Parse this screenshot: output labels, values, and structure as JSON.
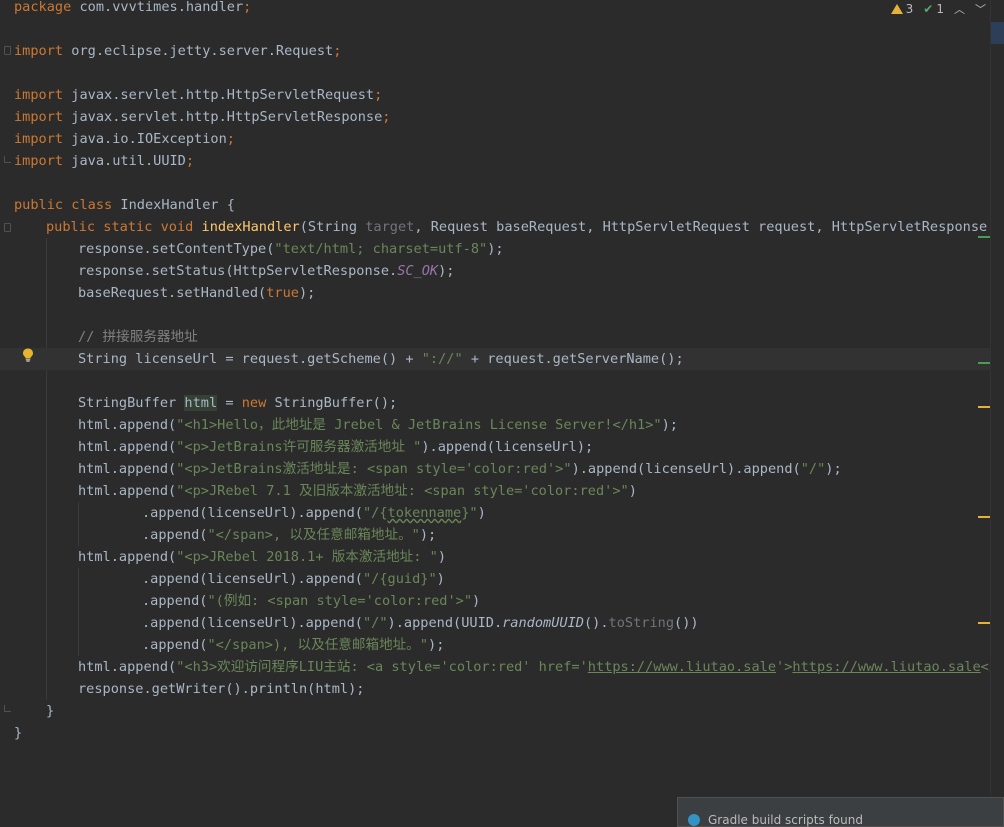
{
  "inspections": {
    "warnings": "3",
    "weak_warnings": "1"
  },
  "code": {
    "package_kw": "package",
    "package_name": " com.vvvtimes.handler",
    "semi": ";",
    "import_kw": "import",
    "imports": [
      " org.eclipse.jetty.server.Request",
      " javax.servlet.http.HttpServletRequest",
      " javax.servlet.http.HttpServletResponse",
      " java.io.IOException",
      " java.util.UUID"
    ],
    "class_decl": {
      "public": "public",
      "class": " class",
      "name": " IndexHandler {"
    },
    "method_decl": {
      "mods": "public static void",
      "name": "indexHandler",
      "open": "(String ",
      "unused_param": "target",
      "rest": ", Request baseRequest, HttpServletRequest request, HttpServletResponse re"
    },
    "l1": {
      "a": "response.setContentType(",
      "s": "\"text/html; charset=utf-8\"",
      "b": ");"
    },
    "l2": {
      "a": "response.setStatus(HttpServletResponse.",
      "f": "SC_OK",
      "b": ");"
    },
    "l3": {
      "a": "baseRequest.setHandled(",
      "k": "true",
      "b": ");"
    },
    "comment": "// 拼接服务器地址",
    "l4": {
      "a": "String licenseUrl = request.getScheme() + ",
      "s": "\"://\"",
      "b": " + request.getServerName();"
    },
    "l5": {
      "a": "StringBuffer ",
      "v": "html",
      "b": " = ",
      "k": "new",
      "c": " StringBuffer();"
    },
    "l6": {
      "a": "html.append(",
      "s": "\"<h1>Hello，此地址是 Jrebel & JetBrains License Server!</h1>\"",
      "b": ");"
    },
    "l7": {
      "a": "html.append(",
      "s": "\"<p>JetBrains许可服务器激活地址 \"",
      "b": ").append(licenseUrl);"
    },
    "l8": {
      "a": "html.append(",
      "s": "\"<p>JetBrains激活地址是: <span style='color:red'>\"",
      "b": ").append(licenseUrl).append(",
      "s2": "\"/\"",
      "c": ");"
    },
    "l9": {
      "a": "html.append(",
      "s": "\"<p>JRebel 7.1 及旧版本激活地址: <span style='color:red'>\"",
      "b": ")"
    },
    "l10": {
      "a": ".append(licenseUrl).append(",
      "s1": "\"/{",
      "typo": "tokenname",
      "s2": "}\"",
      "b": ")"
    },
    "l11": {
      "a": ".append(",
      "s": "\"</span>, 以及任意邮箱地址。\"",
      "b": ");"
    },
    "l12": {
      "a": "html.append(",
      "s": "\"<p>JRebel 2018.1+ 版本激活地址: \"",
      "b": ")"
    },
    "l13": {
      "a": ".append(licenseUrl).append(",
      "s": "\"/{guid}\"",
      "b": ")"
    },
    "l14": {
      "a": ".append(",
      "s": "\"(例如: <span style='color:red'>\"",
      "b": ")"
    },
    "l15": {
      "a": ".append(licenseUrl).append(",
      "s": "\"/\"",
      "b": ").append(UUID.",
      "i": "randomUUID",
      "c": "().",
      "g": "toString",
      "d": "())"
    },
    "l16": {
      "a": ".append(",
      "s": "\"</span>), 以及任意邮箱地址。\"",
      "b": ");"
    },
    "l17": {
      "a": "html.append(",
      "s1": "\"<h3>欢迎访问程序LIU主站: <a style='color:red' href='",
      "u1": "https://www.liutao.sale",
      "s2": "'>",
      "u2": "https://www.liutao.sale",
      "s3": "</a><"
    },
    "l18": "response.getWriter().println(html);",
    "close_method": "}",
    "close_class": "}"
  },
  "notification": {
    "text": "Gradle build scripts found"
  },
  "colors": {
    "background": "#2b2b2b",
    "keyword": "#cc7832",
    "string": "#6a8759",
    "method": "#ffc66d",
    "comment": "#808080",
    "static_field": "#9876aa",
    "warning": "#e5b235"
  }
}
